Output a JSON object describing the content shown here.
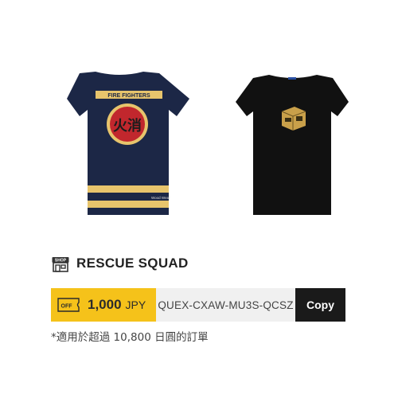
{
  "shop": {
    "icon": "shop-icon",
    "icon_label": "SHOP",
    "name": "RESCUE SQUAD"
  },
  "products": [
    {
      "name": "navy-fire-fighters-tshirt",
      "color": "#1c2746",
      "print_text_top": "FIRE FIGHTERS",
      "print_glyph": "火消",
      "tag_text": "Wood Wear"
    },
    {
      "name": "black-tshirt",
      "color": "#111111"
    }
  ],
  "coupon": {
    "badge_icon": "off-badge-icon",
    "badge_label": "OFF",
    "amount": "1,000",
    "currency": "JPY",
    "code": "QUEX-CXAW-MU3S-QCSZ",
    "copy_label": "Copy",
    "accent_color": "#f5c21a"
  },
  "footnote": "*適用於超過 10,800 日圓的訂單"
}
